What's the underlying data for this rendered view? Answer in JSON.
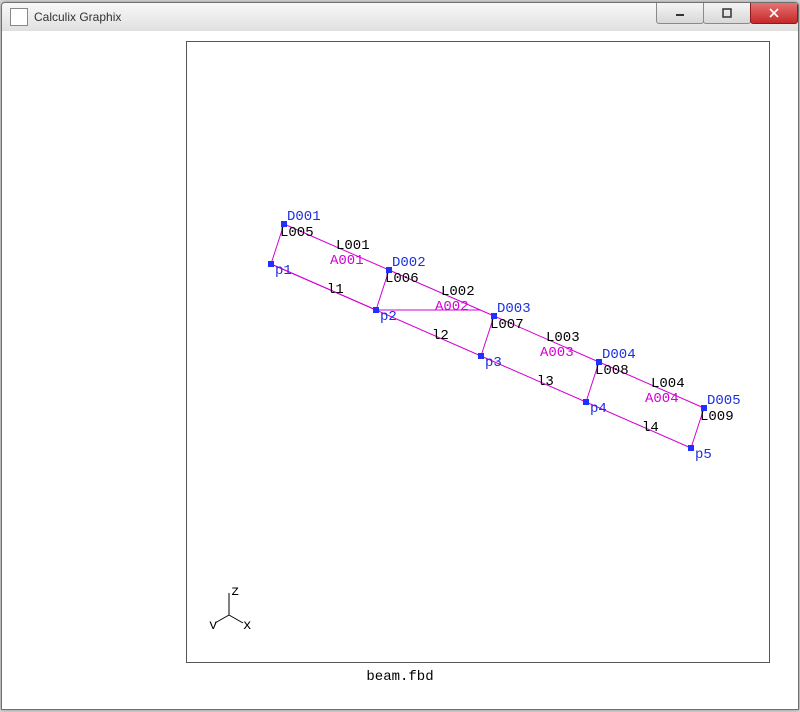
{
  "window": {
    "title": "Calculix Graphix"
  },
  "filename": "beam.fbd",
  "nodes_top": [
    "D001",
    "D002",
    "D003",
    "D004",
    "D005"
  ],
  "nodes_bottom": [
    "p1",
    "p2",
    "p3",
    "p4",
    "p5"
  ],
  "verticals": [
    "L005",
    "L006",
    "L007",
    "L008",
    "L009"
  ],
  "top_edges": [
    "L001",
    "L002",
    "L003",
    "L004"
  ],
  "areas": [
    "A001",
    "A002",
    "A003",
    "A004"
  ],
  "bottom_edges": [
    "l1",
    "l2",
    "l3",
    "l4"
  ],
  "axes": {
    "vert": "z",
    "diag1": "y",
    "diag2": "x"
  }
}
